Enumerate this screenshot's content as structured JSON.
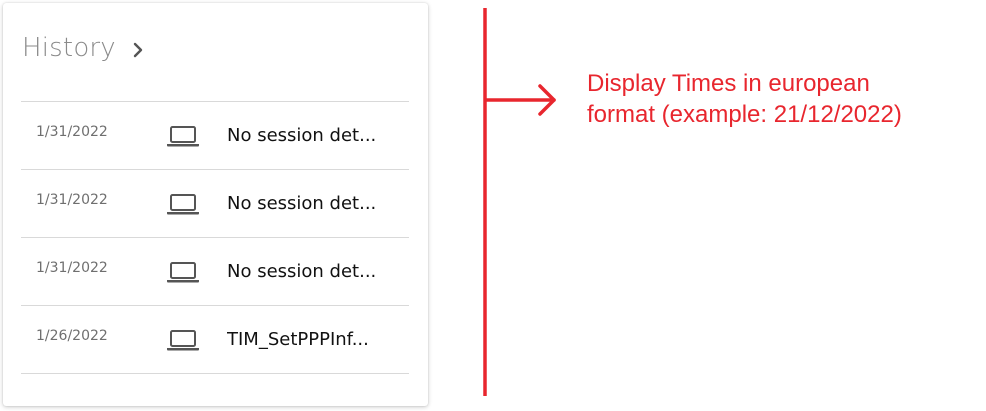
{
  "history": {
    "title": "History",
    "entries": [
      {
        "date": "1/31/2022",
        "icon": "laptop-icon",
        "text": "No session det..."
      },
      {
        "date": "1/31/2022",
        "icon": "laptop-icon",
        "text": "No session det..."
      },
      {
        "date": "1/31/2022",
        "icon": "laptop-icon",
        "text": "No session det..."
      },
      {
        "date": "1/26/2022",
        "icon": "laptop-icon",
        "text": "TIM_SetPPPInf..."
      }
    ]
  },
  "annotation": {
    "text_line1": "Display Times in european",
    "text_line2": "format (example: 21/12/2022)",
    "color": "#e8262e"
  }
}
